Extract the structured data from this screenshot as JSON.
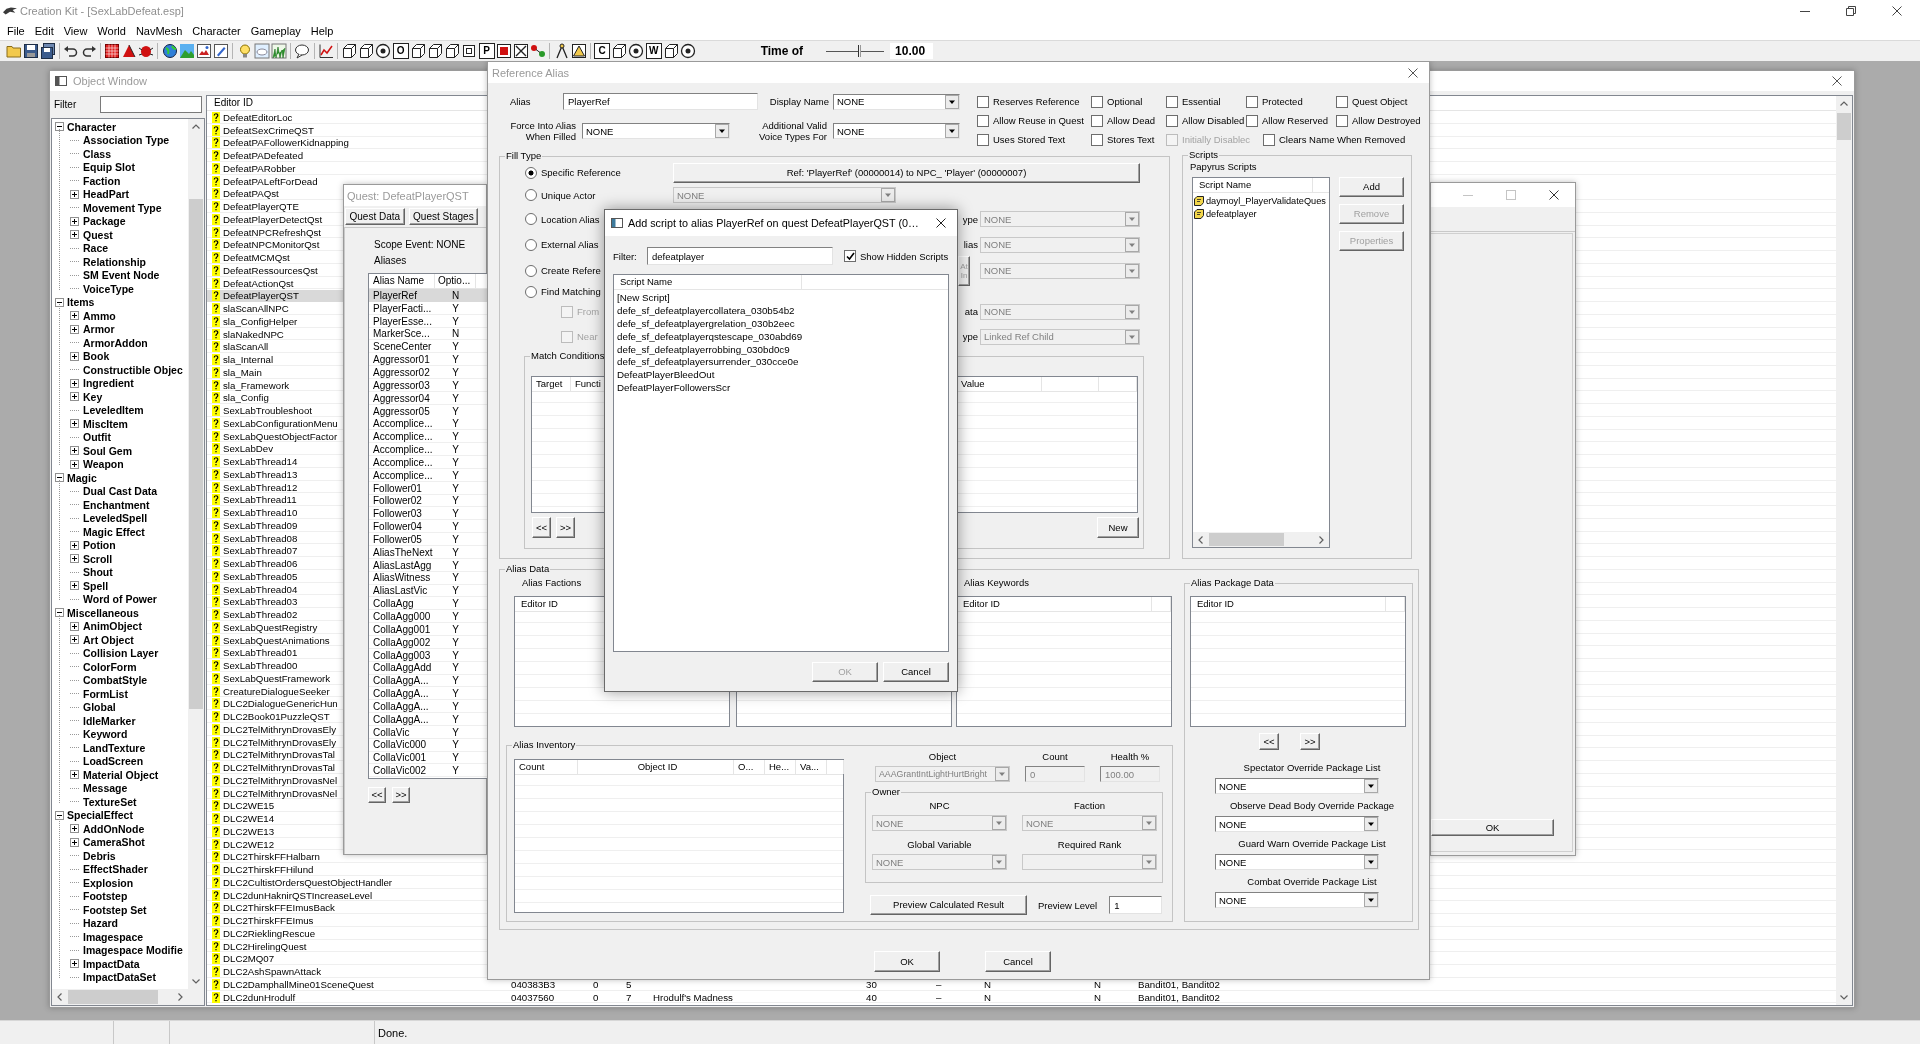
{
  "app": {
    "title": "Creation Kit - [SexLabDefeat.esp]",
    "menu": [
      "File",
      "Edit",
      "View",
      "World",
      "NavMesh",
      "Character",
      "Gameplay",
      "Help"
    ]
  },
  "toolbar": {
    "letter_buttons": [
      "O",
      "P",
      "C",
      "W"
    ],
    "time_label": "Time of",
    "time_slider": {
      "level": 0.57
    },
    "time_value": "10.00"
  },
  "object_window": {
    "title": "Object Window",
    "active": false,
    "filter_label": "Filter",
    "tree": [
      {
        "label": "Character",
        "expanded": true,
        "children": [
          {
            "label": "Association Type",
            "kind": "leaf"
          },
          {
            "label": "Class",
            "kind": "leaf"
          },
          {
            "label": "Equip Slot",
            "kind": "leaf"
          },
          {
            "label": "Faction",
            "kind": "leaf"
          },
          {
            "label": "HeadPart",
            "kind": "folder"
          },
          {
            "label": "Movement Type",
            "kind": "leaf"
          },
          {
            "label": "Package",
            "kind": "folder"
          },
          {
            "label": "Quest",
            "kind": "folder"
          },
          {
            "label": "Race",
            "kind": "leaf"
          },
          {
            "label": "Relationship",
            "kind": "leaf"
          },
          {
            "label": "SM Event Node",
            "kind": "leaf"
          },
          {
            "label": "VoiceType",
            "kind": "leaf"
          }
        ]
      },
      {
        "label": "Items",
        "expanded": true,
        "children": [
          {
            "label": "Ammo",
            "kind": "folder"
          },
          {
            "label": "Armor",
            "kind": "folder"
          },
          {
            "label": "ArmorAddon",
            "kind": "leaf"
          },
          {
            "label": "Book",
            "kind": "folder"
          },
          {
            "label": "Constructible Objec",
            "kind": "leaf"
          },
          {
            "label": "Ingredient",
            "kind": "folder"
          },
          {
            "label": "Key",
            "kind": "folder"
          },
          {
            "label": "LeveledItem",
            "kind": "leaf"
          },
          {
            "label": "MiscItem",
            "kind": "folder"
          },
          {
            "label": "Outfit",
            "kind": "leaf"
          },
          {
            "label": "Soul Gem",
            "kind": "folder"
          },
          {
            "label": "Weapon",
            "kind": "folder"
          }
        ]
      },
      {
        "label": "Magic",
        "expanded": true,
        "children": [
          {
            "label": "Dual Cast Data",
            "kind": "leaf"
          },
          {
            "label": "Enchantment",
            "kind": "leaf"
          },
          {
            "label": "LeveledSpell",
            "kind": "leaf"
          },
          {
            "label": "Magic Effect",
            "kind": "leaf"
          },
          {
            "label": "Potion",
            "kind": "folder"
          },
          {
            "label": "Scroll",
            "kind": "folder"
          },
          {
            "label": "Shout",
            "kind": "leaf"
          },
          {
            "label": "Spell",
            "kind": "folder"
          },
          {
            "label": "Word of Power",
            "kind": "leaf"
          }
        ]
      },
      {
        "label": "Miscellaneous",
        "expanded": true,
        "children": [
          {
            "label": "AnimObject",
            "kind": "folder"
          },
          {
            "label": "Art Object",
            "kind": "folder"
          },
          {
            "label": "Collision Layer",
            "kind": "leaf"
          },
          {
            "label": "ColorForm",
            "kind": "leaf"
          },
          {
            "label": "CombatStyle",
            "kind": "leaf"
          },
          {
            "label": "FormList",
            "kind": "leaf"
          },
          {
            "label": "Global",
            "kind": "leaf"
          },
          {
            "label": "IdleMarker",
            "kind": "leaf"
          },
          {
            "label": "Keyword",
            "kind": "leaf"
          },
          {
            "label": "LandTexture",
            "kind": "leaf"
          },
          {
            "label": "LoadScreen",
            "kind": "leaf"
          },
          {
            "label": "Material Object",
            "kind": "folder"
          },
          {
            "label": "Message",
            "kind": "leaf"
          },
          {
            "label": "TextureSet",
            "kind": "leaf"
          }
        ]
      },
      {
        "label": "SpecialEffect",
        "expanded": true,
        "children": [
          {
            "label": "AddOnNode",
            "kind": "folder"
          },
          {
            "label": "CameraShot",
            "kind": "folder"
          },
          {
            "label": "Debris",
            "kind": "leaf"
          },
          {
            "label": "EffectShader",
            "kind": "leaf"
          },
          {
            "label": "Explosion",
            "kind": "leaf"
          },
          {
            "label": "Footstep",
            "kind": "leaf"
          },
          {
            "label": "Footstep Set",
            "kind": "leaf"
          },
          {
            "label": "Hazard",
            "kind": "leaf"
          },
          {
            "label": "Imagespace",
            "kind": "leaf"
          },
          {
            "label": "Imagespace Modifie",
            "kind": "leaf"
          },
          {
            "label": "ImpactData",
            "kind": "folder"
          },
          {
            "label": "ImpactDataSet",
            "kind": "leaf"
          }
        ]
      }
    ],
    "list": {
      "columns": [
        "Editor ID"
      ],
      "rows": [
        {
          "editor_id": "DefeatEditorLoc",
          "selected": false
        },
        {
          "editor_id": "DefeatSexCrimeQST",
          "selected": false
        },
        {
          "editor_id": "DefeatPAFollowerKidnapping",
          "selected": false
        },
        {
          "editor_id": "DefeatPADefeated",
          "selected": false
        },
        {
          "editor_id": "DefeatPARobber",
          "selected": false
        },
        {
          "editor_id": "DefeatPALeftForDead",
          "selected": false
        },
        {
          "editor_id": "DefeatPAQst",
          "selected": false
        },
        {
          "editor_id": "DefeatPlayerQTE",
          "selected": false
        },
        {
          "editor_id": "DefeatPlayerDetectQst",
          "selected": false
        },
        {
          "editor_id": "DefeatNPCRefreshQst",
          "selected": false
        },
        {
          "editor_id": "DefeatNPCMonitorQst",
          "selected": false
        },
        {
          "editor_id": "DefeatMCMQst",
          "selected": false
        },
        {
          "editor_id": "DefeatRessourcesQst",
          "selected": false
        },
        {
          "editor_id": "DefeatActionQst",
          "selected": false
        },
        {
          "editor_id": "DefeatPlayerQST",
          "selected": true
        },
        {
          "editor_id": "slaScanAllNPC",
          "selected": false
        },
        {
          "editor_id": "sla_ConfigHelper",
          "selected": false
        },
        {
          "editor_id": "slaNakedNPC",
          "selected": false
        },
        {
          "editor_id": "slaScanAll",
          "selected": false
        },
        {
          "editor_id": "sla_Internal",
          "selected": false
        },
        {
          "editor_id": "sla_Main",
          "selected": false
        },
        {
          "editor_id": "sla_Framework",
          "selected": false
        },
        {
          "editor_id": "sla_Config",
          "selected": false
        },
        {
          "editor_id": "SexLabTroubleshoot",
          "selected": false
        },
        {
          "editor_id": "SexLabConfigurationMenu",
          "selected": false
        },
        {
          "editor_id": "SexLabQuestObjectFactor",
          "selected": false
        },
        {
          "editor_id": "SexLabDev",
          "selected": false
        },
        {
          "editor_id": "SexLabThread14",
          "selected": false
        },
        {
          "editor_id": "SexLabThread13",
          "selected": false
        },
        {
          "editor_id": "SexLabThread12",
          "selected": false
        },
        {
          "editor_id": "SexLabThread11",
          "selected": false
        },
        {
          "editor_id": "SexLabThread10",
          "selected": false
        },
        {
          "editor_id": "SexLabThread09",
          "selected": false
        },
        {
          "editor_id": "SexLabThread08",
          "selected": false
        },
        {
          "editor_id": "SexLabThread07",
          "selected": false
        },
        {
          "editor_id": "SexLabThread06",
          "selected": false
        },
        {
          "editor_id": "SexLabThread05",
          "selected": false
        },
        {
          "editor_id": "SexLabThread04",
          "selected": false
        },
        {
          "editor_id": "SexLabThread03",
          "selected": false
        },
        {
          "editor_id": "SexLabThread02",
          "selected": false
        },
        {
          "editor_id": "SexLabQuestRegistry",
          "selected": false
        },
        {
          "editor_id": "SexLabQuestAnimations",
          "selected": false
        },
        {
          "editor_id": "SexLabThread01",
          "selected": false
        },
        {
          "editor_id": "SexLabThread00",
          "selected": false
        },
        {
          "editor_id": "SexLabQuestFramework",
          "selected": false
        },
        {
          "editor_id": "CreatureDialogueSeeker",
          "selected": false
        },
        {
          "editor_id": "DLC2DialogueGenericHun",
          "selected": false
        },
        {
          "editor_id": "DLC2Book01PuzzleQST",
          "selected": false
        },
        {
          "editor_id": "DLC2TelMithrynDrovasEly",
          "selected": false
        },
        {
          "editor_id": "DLC2TelMithrynDrovasEly",
          "selected": false
        },
        {
          "editor_id": "DLC2TelMithrynDrovasTal",
          "selected": false
        },
        {
          "editor_id": "DLC2TelMithrynDrovasTal",
          "selected": false
        },
        {
          "editor_id": "DLC2TelMithrynDrovasNel",
          "selected": false
        },
        {
          "editor_id": "DLC2TelMithrynDrovasNel",
          "selected": false
        },
        {
          "editor_id": "DLC2WE15",
          "selected": false
        },
        {
          "editor_id": "DLC2WE14",
          "selected": false
        },
        {
          "editor_id": "DLC2WE13",
          "selected": false
        },
        {
          "editor_id": "DLC2WE12",
          "selected": false
        },
        {
          "editor_id": "DLC2ThirskFFHalbarn",
          "selected": false
        },
        {
          "editor_id": "DLC2ThirskFFHilund",
          "selected": false
        },
        {
          "editor_id": "DLC2CultistOrdersQuestObjectHandler",
          "selected": false
        },
        {
          "editor_id": "DLC2dunHaknirQSTIncreaseLevel",
          "selected": false
        },
        {
          "editor_id": "DLC2ThirskFFEImusBack",
          "selected": false
        },
        {
          "editor_id": "DLC2ThirskFFEImus",
          "selected": false
        },
        {
          "editor_id": "DLC2RieklingRescue",
          "selected": false
        },
        {
          "editor_id": "DLC2HirelingQuest",
          "selected": false
        },
        {
          "editor_id": "DLC2MQ07",
          "selected": false
        },
        {
          "editor_id": "DLC2AshSpawnAttack",
          "selected": false
        },
        {
          "editor_id": "DLC2DamphallMine01SceneQuest",
          "selected": false,
          "column_2": "040383B3",
          "column_3": "0",
          "column_4": "5",
          "column_6": "30",
          "column_7": "–",
          "column_8": "N",
          "column_9": "N",
          "column_10": "Bandit01, Bandit02"
        },
        {
          "editor_id": "DLC2dunHrodulf",
          "selected": false,
          "column_2": "04037560",
          "column_3": "0",
          "column_4": "7",
          "column_5": "Hrodulf's Madness",
          "column_6": "40",
          "column_7": "–",
          "column_8": "N",
          "column_9": "N",
          "column_10": "Bandit01, Bandit02"
        }
      ]
    }
  },
  "blank_window": {
    "button": "OK"
  },
  "quest_window": {
    "title": "Quest: DefeatPlayerQST",
    "active": false,
    "tabs": [
      "Quest Data",
      "Quest Stages"
    ],
    "scope_event": "Scope Event: NONE",
    "aliases_label": "Aliases",
    "alias_list": {
      "columns": [
        "Alias Name",
        "Optio..."
      ],
      "rows": [
        {
          "name": "PlayerRef",
          "optional": "N",
          "selected": true
        },
        {
          "name": "PlayerFacti...",
          "optional": "Y",
          "selected": false
        },
        {
          "name": "PlayerEsse...",
          "optional": "Y",
          "selected": false
        },
        {
          "name": "MarkerSce...",
          "optional": "N",
          "selected": false
        },
        {
          "name": "SceneCenter",
          "optional": "Y",
          "selected": false
        },
        {
          "name": "Aggressor01",
          "optional": "Y",
          "selected": false
        },
        {
          "name": "Aggressor02",
          "optional": "Y",
          "selected": false
        },
        {
          "name": "Aggressor03",
          "optional": "Y",
          "selected": false
        },
        {
          "name": "Aggressor04",
          "optional": "Y",
          "selected": false
        },
        {
          "name": "Aggressor05",
          "optional": "Y",
          "selected": false
        },
        {
          "name": "Accomplice...",
          "optional": "Y",
          "selected": false
        },
        {
          "name": "Accomplice...",
          "optional": "Y",
          "selected": false
        },
        {
          "name": "Accomplice...",
          "optional": "Y",
          "selected": false
        },
        {
          "name": "Accomplice...",
          "optional": "Y",
          "selected": false
        },
        {
          "name": "Accomplice...",
          "optional": "Y",
          "selected": false
        },
        {
          "name": "Follower01",
          "optional": "Y",
          "selected": false
        },
        {
          "name": "Follower02",
          "optional": "Y",
          "selected": false
        },
        {
          "name": "Follower03",
          "optional": "Y",
          "selected": false
        },
        {
          "name": "Follower04",
          "optional": "Y",
          "selected": false
        },
        {
          "name": "Follower05",
          "optional": "Y",
          "selected": false
        },
        {
          "name": "AliasTheNext",
          "optional": "Y",
          "selected": false
        },
        {
          "name": "AliasLastAgg",
          "optional": "Y",
          "selected": false
        },
        {
          "name": "AliasWitness",
          "optional": "Y",
          "selected": false
        },
        {
          "name": "AliasLastVic",
          "optional": "Y",
          "selected": false
        },
        {
          "name": "CollaAgg",
          "optional": "Y",
          "selected": false
        },
        {
          "name": "CollaAgg000",
          "optional": "Y",
          "selected": false
        },
        {
          "name": "CollaAgg001",
          "optional": "Y",
          "selected": false
        },
        {
          "name": "CollaAgg002",
          "optional": "Y",
          "selected": false
        },
        {
          "name": "CollaAgg003",
          "optional": "Y",
          "selected": false
        },
        {
          "name": "CollaAggAdd",
          "optional": "Y",
          "selected": false
        },
        {
          "name": "CollaAggA...",
          "optional": "Y",
          "selected": false
        },
        {
          "name": "CollaAggA...",
          "optional": "Y",
          "selected": false
        },
        {
          "name": "CollaAggA...",
          "optional": "Y",
          "selected": false
        },
        {
          "name": "CollaAggA...",
          "optional": "Y",
          "selected": false
        },
        {
          "name": "CollaVic",
          "optional": "Y",
          "selected": false
        },
        {
          "name": "CollaVic000",
          "optional": "Y",
          "selected": false
        },
        {
          "name": "CollaVic001",
          "optional": "Y",
          "selected": false
        },
        {
          "name": "CollaVic002",
          "optional": "Y",
          "selected": false
        }
      ]
    },
    "nav_buttons": [
      "<<",
      ">>"
    ]
  },
  "reference_alias": {
    "title": "Reference Alias",
    "active": false,
    "alias": {
      "label": "Alias",
      "value": "PlayerRef"
    },
    "display_name": {
      "label": "Display Name",
      "value": "NONE",
      "disabled": false
    },
    "force_into": {
      "label": "Force Into Alias When Filled",
      "value": "NONE",
      "disabled": false
    },
    "voice_types": {
      "label": "Additional Valid Voice Types For",
      "value": "NONE",
      "disabled": false
    },
    "flags": [
      {
        "label": "Reserves Reference",
        "checked": false,
        "disabled": false
      },
      {
        "label": "Optional",
        "checked": false,
        "disabled": false
      },
      {
        "label": "Essential",
        "checked": false,
        "disabled": false
      },
      {
        "label": "Protected",
        "checked": false,
        "disabled": false
      },
      {
        "label": "Quest Object",
        "checked": false,
        "disabled": false
      },
      {
        "label": "Allow Reuse in Quest",
        "checked": false,
        "disabled": false
      },
      {
        "label": "Allow Dead",
        "checked": false,
        "disabled": false
      },
      {
        "label": "Allow Disabled",
        "checked": false,
        "disabled": false
      },
      {
        "label": "Allow Reserved",
        "checked": false,
        "disabled": false
      },
      {
        "label": "Allow Destroyed",
        "checked": false,
        "disabled": false
      },
      {
        "label": "Uses Stored Text",
        "checked": false,
        "disabled": false
      },
      {
        "label": "Stores Text",
        "checked": false,
        "disabled": false
      },
      {
        "label": "Initially Disablec",
        "checked": false,
        "disabled": true
      },
      {
        "label": "Clears Name When Removed",
        "checked": false,
        "disabled": false
      }
    ],
    "fill_type": {
      "label": "Fill Type",
      "options": [
        {
          "label": "Specific Reference",
          "selected": true
        },
        {
          "label": "Unique Actor",
          "selected": false
        },
        {
          "label": "Location Alias",
          "selected": false
        },
        {
          "label": "External Alias",
          "selected": false
        },
        {
          "label": "Create Refere",
          "selected": false
        },
        {
          "label": "Find Matching",
          "selected": false
        }
      ],
      "ref_button": "Ref: 'PlayerRef' (00000014) to NPC_ 'Player' (00000007)",
      "unique_actor": {
        "value": "NONE",
        "disabled": true
      },
      "find_checks": [
        {
          "label": "From",
          "checked": false,
          "disabled": true
        },
        {
          "label": "Near",
          "checked": false,
          "disabled": true
        }
      ],
      "side_fields": [
        {
          "label": "ype",
          "value": "NONE",
          "disabled": true
        },
        {
          "label": "lias",
          "value": "NONE",
          "disabled": true
        },
        {
          "button": "At In",
          "value": "NONE",
          "disabled": true
        },
        {
          "label": "ata",
          "value": "NONE",
          "disabled": true
        },
        {
          "label": "ype",
          "value": "Linked Ref Child",
          "disabled": true
        }
      ],
      "match_conditions": {
        "label": "Match Conditions",
        "columns": [
          "Target",
          "Functi",
          "Value"
        ],
        "nav_buttons": [
          "<<",
          ">>"
        ],
        "new_button": "New"
      }
    },
    "scripts": {
      "label": "Scripts",
      "sublabel": "Papyrus Scripts",
      "column": "Script Name",
      "items": [
        "daymoyl_PlayerValidateQues",
        "defeatplayer"
      ],
      "buttons": [
        {
          "label": "Add",
          "disabled": false
        },
        {
          "label": "Remove",
          "disabled": true
        },
        {
          "label": "Properties",
          "disabled": true
        }
      ]
    },
    "alias_data": {
      "label": "Alias Data",
      "factions": {
        "label": "Alias Factions",
        "column": "Editor ID"
      },
      "keywords": {
        "label": "Alias Keywords",
        "column": "Editor ID"
      },
      "package_data": {
        "label": "Alias Package Data",
        "column": "Editor ID",
        "nav_buttons": [
          "<<",
          ">>"
        ],
        "overrides": [
          {
            "label": "Spectator Override Package List",
            "value": "NONE",
            "disabled": false
          },
          {
            "label": "Observe Dead Body Override Package",
            "value": "NONE",
            "disabled": false
          },
          {
            "label": "Guard Warn Override Package List",
            "value": "NONE",
            "disabled": false
          },
          {
            "label": "Combat Override Package List",
            "value": "NONE",
            "disabled": false
          }
        ]
      },
      "inventory": {
        "label": "Alias Inventory",
        "columns": [
          "Count",
          "Object ID",
          "O...",
          "He...",
          "Va..."
        ],
        "object": {
          "label": "Object",
          "value": "AAAGrantIntLightHurtBright",
          "disabled": true
        },
        "count": {
          "label": "Count",
          "value": "0",
          "disabled": true
        },
        "health": {
          "label": "Health %",
          "value": "100.00",
          "disabled": true
        },
        "owner": {
          "label": "Owner",
          "npc": {
            "label": "NPC",
            "value": "NONE",
            "disabled": true
          },
          "faction": {
            "label": "Faction",
            "value": "NONE",
            "disabled": true
          },
          "global_variable": {
            "label": "Global Variable",
            "value": "NONE",
            "disabled": true
          },
          "required_rank": {
            "label": "Required Rank",
            "disabled": true
          }
        },
        "preview_button": "Preview Calculated Result",
        "preview_level": {
          "label": "Preview Level",
          "value": "1"
        }
      }
    },
    "buttons": [
      "OK",
      "Cancel"
    ]
  },
  "add_script": {
    "title": "Add script to alias PlayerRef on quest DefeatPlayerQST (0…",
    "active": true,
    "filter": {
      "label": "Filter:",
      "value": "defeatplayer"
    },
    "show_hidden": {
      "label": "Show Hidden Scripts",
      "checked": true
    },
    "column": "Script Name",
    "scripts": [
      "[New Script]",
      "defe_sf_defeatplayercollatera_030b54b2",
      "defe_sf_defeatplayergrelation_030b2eec",
      "defe_sf_defeatplayerqstescape_030abd69",
      "defe_sf_defeatplayerrobbing_030bd0c9",
      "defe_sf_defeatplayersurrender_030cce0e",
      "DefeatPlayerBleedOut",
      "DefeatPlayerFollowersScr"
    ],
    "buttons": [
      {
        "label": "OK",
        "disabled": true
      },
      {
        "label": "Cancel",
        "disabled": false
      }
    ]
  },
  "status_bar": {
    "text": "Done."
  }
}
